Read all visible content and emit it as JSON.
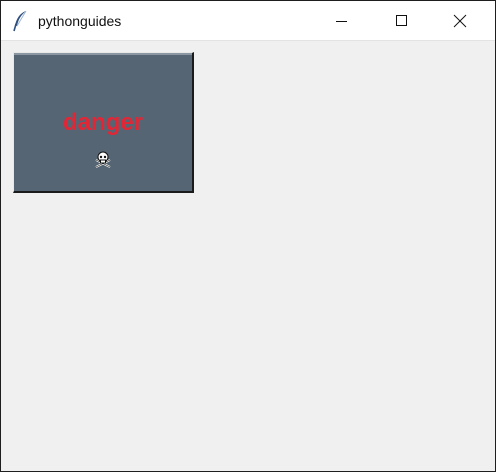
{
  "window": {
    "title": "pythonguides",
    "controls": {
      "minimize_icon": "minimize-icon",
      "maximize_icon": "maximize-icon",
      "close_icon": "close-icon"
    },
    "app_icon": "tk-feather-icon"
  },
  "button": {
    "label": "danger",
    "cursor_icon": "pirate-icon",
    "background": "#566573",
    "foreground": "#e32636"
  },
  "colors": {
    "window_bg": "#f0f0f0",
    "titlebar_bg": "#ffffff"
  }
}
